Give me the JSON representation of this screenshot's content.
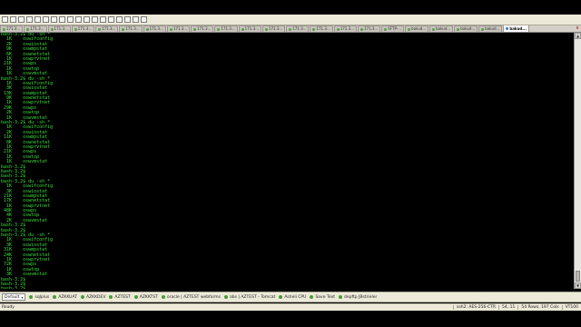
{
  "tabs": [
    {
      "label": "171.3...",
      "active": false
    },
    {
      "label": "171.3...",
      "active": false
    },
    {
      "label": "171.3...",
      "active": false
    },
    {
      "label": "171.3...",
      "active": false
    },
    {
      "label": "171.3...",
      "active": false
    },
    {
      "label": "171.3...",
      "active": false
    },
    {
      "label": "171.3...",
      "active": false
    },
    {
      "label": "171.3...",
      "active": false
    },
    {
      "label": "171.3...",
      "active": false
    },
    {
      "label": "171.3...",
      "active": false
    },
    {
      "label": "171.3...",
      "active": false
    },
    {
      "label": "171.3...",
      "active": false
    },
    {
      "label": "171.3...",
      "active": false
    },
    {
      "label": "171.3...",
      "active": false
    },
    {
      "label": "171.3...",
      "active": false
    },
    {
      "label": "171.3...",
      "active": false
    },
    {
      "label": "SFTP-...",
      "active": false
    },
    {
      "label": "bakud...",
      "active": false
    },
    {
      "label": "bakud...",
      "active": false
    },
    {
      "label": "bakud...",
      "active": false
    },
    {
      "label": "bakud...",
      "active": false
    },
    {
      "label": "bakud...",
      "active": true
    }
  ],
  "tab_close_glyph": "x",
  "toolbar_icon_count": 18,
  "terminal_lines": [
    "bash-3.2$ du -sh *",
    "  1K    oswifconfig",
    "  2K    oswiostat",
    "  9K    oswmpstat",
    "  6K    oswnetstat",
    "  1K    oswprvtnet",
    " 21K    oswps",
    "  1K    oswtop",
    "  1K    oswvmstat",
    "bash-3.2$ du -sh *",
    "  1K    oswifconfig",
    "  3K    oswiostat",
    " 13K    oswmpstat",
    "  9K    oswnetstat",
    "  1K    oswprvtnet",
    " 29K    oswps",
    "  2K    oswtop",
    "  1K    oswvmstat",
    "bash-3.2$ du -sh *",
    "  1K    oswifconfig",
    "  2K    oswiostat",
    " 11K    oswmpstat",
    "  8K    oswnetstat",
    "  1K    oswprvtnet",
    " 21K    oswps",
    "  1K    oswtop",
    "  1K    oswvmstat",
    "bash-3.2$",
    "bash-3.2$",
    "bash-3.2$",
    "bash-3.2$ du -sh *",
    "  1K    oswifconfig",
    "  3K    oswiostat",
    " 21K    oswmpstat",
    " 17K    oswnetstat",
    "  1K    oswprvtnet",
    " 48K    oswps",
    "  4K    oswtop",
    "  2K    oswvmstat",
    "bash-3.2$",
    "bash-3.2$",
    "bash-3.2$ du -sh *",
    "  1K    oswifconfig",
    "  3K    oswiostat",
    " 31K    oswmpstat",
    " 24K    oswnetstat",
    "  1K    oswprvtnet",
    " 72K    oswps",
    "  1K    oswtop",
    "  3K    oswvmstat",
    "bash-3.2$",
    "bash-3.2$",
    "bash-3.2$"
  ],
  "sessions": [
    {
      "label": "Default",
      "default": true
    },
    {
      "label": "sqlplus"
    },
    {
      "label": "AZKKUAT"
    },
    {
      "label": "AZKKDEV"
    },
    {
      "label": "AZTEST"
    },
    {
      "label": "AZKKTST"
    },
    {
      "label": "oracle | AZTEST webforms"
    },
    {
      "label": "abs | AZTEST - Tomcat"
    },
    {
      "label": "Asheli CPU"
    },
    {
      "label": "Save Text"
    },
    {
      "label": "depftp JBstrieler"
    }
  ],
  "status": {
    "left": "Ready",
    "cells": [
      "ssh2: AES-256-CTR",
      "54,  11",
      "54 Rows, 197 Cols",
      "VT100"
    ]
  },
  "colors": {
    "terminal_bg": "#000000",
    "terminal_fg": "#3cdc3c",
    "chrome": "#ece9d8"
  }
}
